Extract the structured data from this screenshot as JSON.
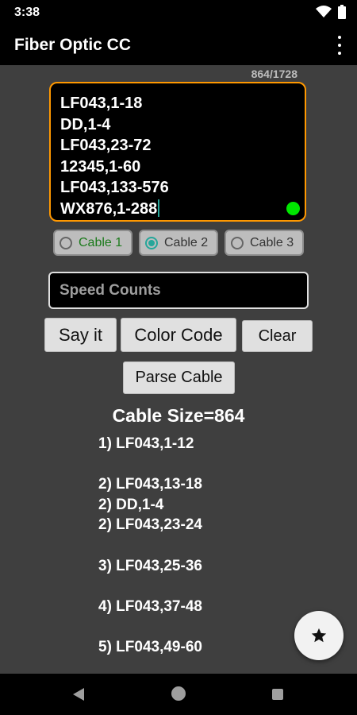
{
  "status_bar": {
    "time": "3:38",
    "icons": [
      "wifi-icon",
      "battery-icon"
    ]
  },
  "app_bar": {
    "title": "Fiber Optic CC",
    "menu_icon": "more-vert-icon"
  },
  "editor": {
    "counter": "864/1728",
    "lines": [
      "LF043,1-18",
      "DD,1-4",
      "LF043,23-72",
      "12345,1-60",
      "LF043,133-576",
      "WX876,1-288"
    ],
    "indicator_color": "#00e600",
    "border_color": "#ff9800"
  },
  "cable_options": [
    {
      "label": "Cable 1",
      "selected": false
    },
    {
      "label": "Cable 2",
      "selected": true
    },
    {
      "label": "Cable 3",
      "selected": false
    }
  ],
  "speed_counts": {
    "placeholder": "Speed Counts",
    "value": ""
  },
  "buttons": {
    "say_it": "Say it",
    "color_code": "Color Code",
    "clear": "Clear",
    "parse_cable": "Parse Cable"
  },
  "cable_size": "Cable Size=864",
  "results": [
    "1) LF043,1-12",
    "",
    "2) LF043,13-18",
    "2) DD,1-4",
    "2) LF043,23-24",
    "",
    "3) LF043,25-36",
    "",
    "4) LF043,37-48",
    "",
    "5) LF043,49-60"
  ],
  "fab": {
    "icon": "star-icon"
  },
  "nav_bar": {
    "icons": [
      "back-icon",
      "home-icon",
      "recents-icon"
    ]
  }
}
